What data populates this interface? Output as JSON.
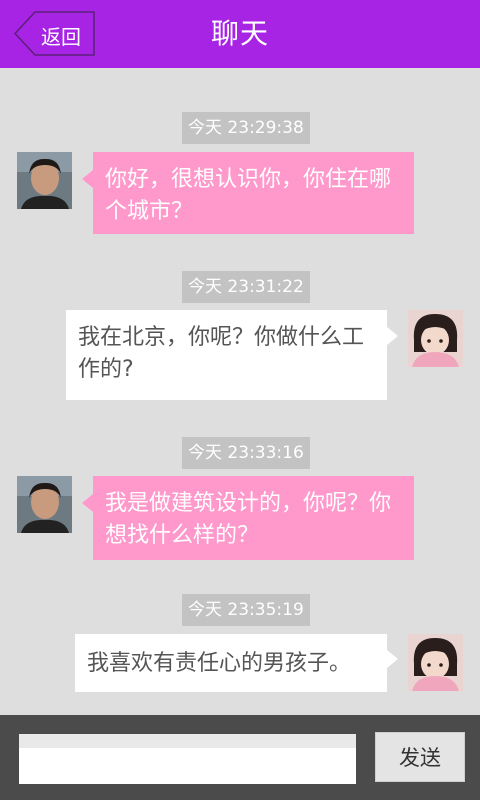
{
  "header": {
    "back_label": "返回",
    "title": "聊天"
  },
  "messages": [
    {
      "time": "今天 23:29:38",
      "side": "left",
      "text": "你好，很想认识你，你住在哪个城市？"
    },
    {
      "time": "今天 23:31:22",
      "side": "right",
      "text": "我在北京，你呢？你做什么工作的?"
    },
    {
      "time": "今天 23:33:16",
      "side": "left",
      "text": "我是做建筑设计的，你呢？你想找什么样的？"
    },
    {
      "time": "今天 23:35:19",
      "side": "right",
      "text": "我喜欢有责任心的男孩子。"
    }
  ],
  "input": {
    "value": "",
    "send_label": "发送"
  },
  "colors": {
    "header": "#a824e4",
    "background": "#dedede",
    "bubble_left": "#ff99cc",
    "bubble_right": "#ffffff",
    "time_badge": "#c3c3c3",
    "bottom_bar": "#4b4b4b"
  }
}
